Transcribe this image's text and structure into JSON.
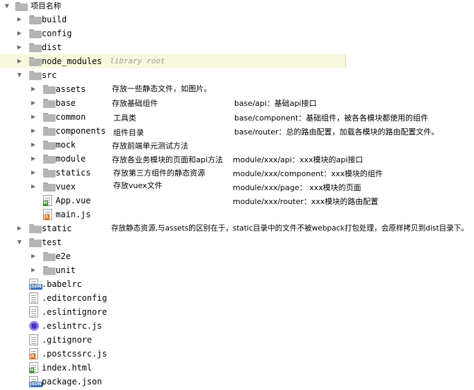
{
  "tree": {
    "root": "项目名称",
    "build": "build",
    "config": "config",
    "dist": "dist",
    "node_modules": "node_modules",
    "node_modules_tag": "library root",
    "src": "src",
    "assets": "assets",
    "base": "base",
    "common": "common",
    "components": "components",
    "mock": "mock",
    "module": "module",
    "statics": "statics",
    "vuex": "vuex",
    "app_vue": "App.vue",
    "main_js": "main.js",
    "static": "static",
    "test": "test",
    "e2e": "e2e",
    "unit": "unit",
    "babelrc": ".babelrc",
    "editorconfig": ".editorconfig",
    "eslintignore": ".eslintignore",
    "eslintrc": ".eslintrc.js",
    "gitignore": ".gitignore",
    "postcssrc": ".postcssrc.js",
    "index_html": "index.html",
    "package_json": "package.json"
  },
  "badges": {
    "js": "JS",
    "h": "H",
    "json": "JSON"
  },
  "notes": {
    "assets": "存放一些静态文件，如图片。",
    "base": "存放基础组件",
    "common": "工具类",
    "components": "组件目录",
    "mock": "存放前端单元测试方法",
    "module": "存放各业务模块的页面和api方法",
    "statics": "存放第三方组件的静态资源",
    "vuex": "存放vuex文件",
    "static": "存放静态资源,与assets的区别在于，static目录中的文件不被webpack打包处理，会原样拷贝到dist目录下。",
    "base_api": "base/api：基础api接口",
    "base_component": "base/component：基础组件，被各各模块都使用的组件",
    "base_router": "base/router：总的路由配置，加载各模块的路由配置文件。",
    "module_api": "module/xxx/api：xxx模块的api接口",
    "module_component": "module/xxx/component：xxx模块的组件",
    "module_page": "module/xxx/page： xxx模块的页面",
    "module_router": "module/xxx/router：xxx模块的路由配置"
  },
  "colors": {
    "selected_row": "#f8f8dc",
    "folder": "#b5b5b5",
    "js_badge": "#e06c1a",
    "html_badge": "#3f8f36",
    "json_badge": "#3a6fb5",
    "eslint": "#4b32c3"
  },
  "icons": {
    "expanded": "chevron-down-icon",
    "collapsed": "chevron-right-icon",
    "folder": "folder-icon",
    "file": "file-icon",
    "eslint": "eslint-icon"
  }
}
